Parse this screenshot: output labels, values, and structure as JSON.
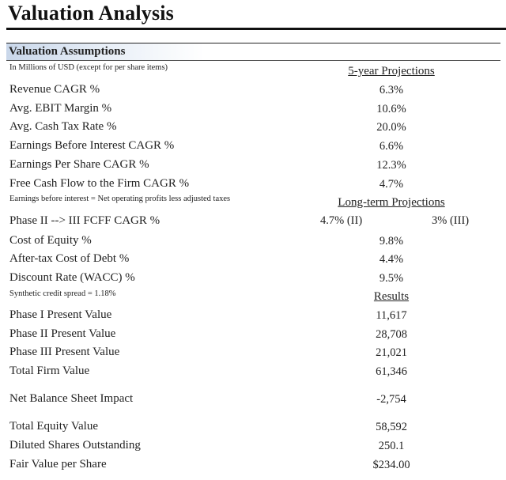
{
  "page": {
    "title": "Valuation Analysis"
  },
  "section": {
    "title": "Valuation Assumptions",
    "units_note": "In Millions of USD (except for per share items)"
  },
  "five_year": {
    "header": "5-year Projections",
    "rows": [
      {
        "label": "Revenue CAGR %",
        "value": "6.3%"
      },
      {
        "label": "Avg. EBIT Margin %",
        "value": "10.6%"
      },
      {
        "label": "Avg. Cash Tax Rate %",
        "value": "20.0%"
      },
      {
        "label": "Earnings Before Interest CAGR %",
        "value": "6.6%"
      },
      {
        "label": "Earnings Per Share CAGR %",
        "value": "12.3%"
      },
      {
        "label": "Free Cash Flow to the Firm CAGR %",
        "value": "4.7%"
      }
    ],
    "footnote": "Earnings before interest = Net operating profits less adjusted taxes"
  },
  "long_term": {
    "header": "Long-term Projections",
    "phase_row": {
      "label": "Phase II --> III FCFF CAGR %",
      "phase_ii": "4.7% (II)",
      "phase_iii": "3% (III)"
    },
    "rows": [
      {
        "label": "Cost of Equity %",
        "value": "9.8%"
      },
      {
        "label": "After-tax Cost of Debt %",
        "value": "4.4%"
      },
      {
        "label": "Discount Rate (WACC) %",
        "value": "9.5%"
      }
    ],
    "footnote": "Synthetic credit spread = 1.18%"
  },
  "results": {
    "header": "Results",
    "rows": [
      {
        "label": "Phase I Present Value",
        "value": "11,617"
      },
      {
        "label": "Phase II Present Value",
        "value": "28,708"
      },
      {
        "label": "Phase III Present Value",
        "value": "21,021"
      },
      {
        "label": "Total Firm Value",
        "value": "61,346"
      },
      {
        "label": "Net Balance Sheet Impact",
        "value": "-2,754"
      },
      {
        "label": "Total Equity Value",
        "value": "58,592"
      },
      {
        "label": "Diluted Shares Outstanding",
        "value": "250.1"
      },
      {
        "label": "Fair Value per Share",
        "value": "$234.00"
      }
    ]
  }
}
